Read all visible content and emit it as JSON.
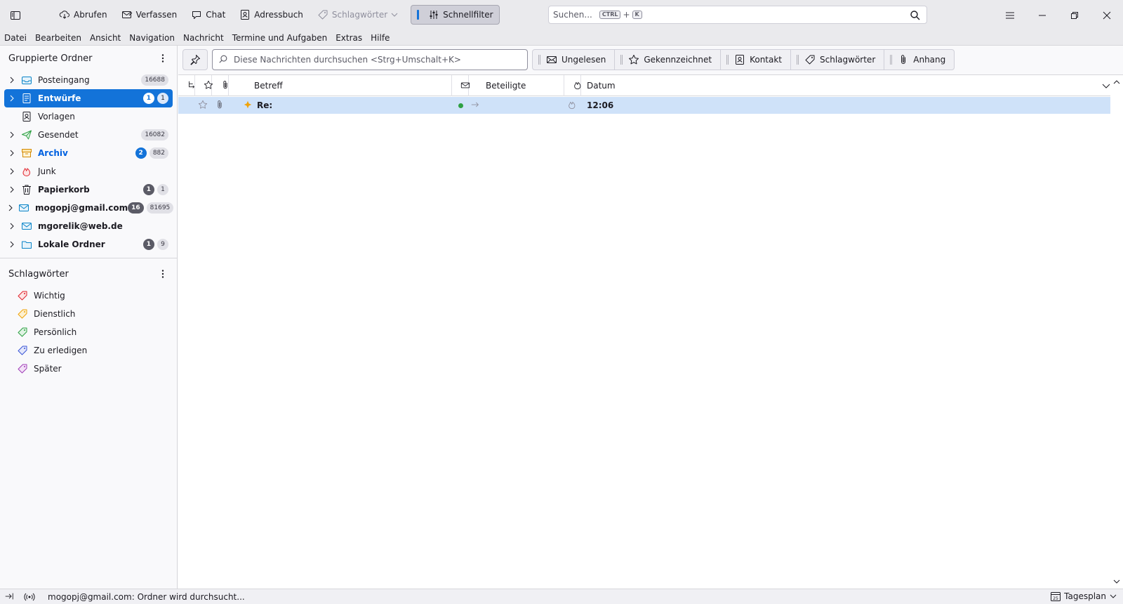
{
  "toolbar": {
    "abrufen": "Abrufen",
    "verfassen": "Verfassen",
    "chat": "Chat",
    "adressbuch": "Adressbuch",
    "schlagwoerter": "Schlagwörter",
    "schnellfilter": "Schnellfilter",
    "search_placeholder": "Suchen...",
    "search_kbd1": "CTRL",
    "search_plus": "+",
    "search_kbd2": "K"
  },
  "menu": {
    "datei": "Datei",
    "bearbeiten": "Bearbeiten",
    "ansicht": "Ansicht",
    "navigation": "Navigation",
    "nachricht": "Nachricht",
    "termine": "Termine und Aufgaben",
    "extras": "Extras",
    "hilfe": "Hilfe"
  },
  "folders": {
    "title": "Gruppierte Ordner",
    "items": [
      {
        "name": "Posteingang",
        "unread": "",
        "total": "16688"
      },
      {
        "name": "Entwürfe",
        "unread": "1",
        "total": "1"
      },
      {
        "name": "Vorlagen",
        "unread": "",
        "total": ""
      },
      {
        "name": "Gesendet",
        "unread": "",
        "total": "16082"
      },
      {
        "name": "Archiv",
        "unread": "2",
        "total": "882"
      },
      {
        "name": "Junk",
        "unread": "",
        "total": ""
      },
      {
        "name": "Papierkorb",
        "unread": "1",
        "total": "1"
      },
      {
        "name": "mogopj@gmail.com",
        "unread": "16",
        "total": "81695"
      },
      {
        "name": "mgorelik@web.de",
        "unread": "",
        "total": ""
      },
      {
        "name": "Lokale Ordner",
        "unread": "1",
        "total": "9"
      }
    ]
  },
  "tags": {
    "title": "Schlagwörter",
    "items": [
      {
        "name": "Wichtig",
        "color": "#e0242d"
      },
      {
        "name": "Dienstlich",
        "color": "#f0a30a"
      },
      {
        "name": "Persönlich",
        "color": "#2ea043"
      },
      {
        "name": "Zu erledigen",
        "color": "#3b55d6"
      },
      {
        "name": "Später",
        "color": "#a03fb7"
      }
    ]
  },
  "quickfilter": {
    "search_placeholder": "Diese Nachrichten durchsuchen <Strg+Umschalt+K>",
    "ungelesen": "Ungelesen",
    "gekennzeichnet": "Gekennzeichnet",
    "kontakt": "Kontakt",
    "schlagwoerter": "Schlagwörter",
    "anhang": "Anhang"
  },
  "thread": {
    "col_betreff": "Betreff",
    "col_beteiligte": "Beteiligte",
    "col_datum": "Datum",
    "rows": [
      {
        "subject": "Re:",
        "participants": "",
        "date": "12:06"
      }
    ]
  },
  "status": {
    "text": "mogopj@gmail.com: Ordner wird durchsucht...",
    "today_pane": "Tagesplan"
  },
  "colors": {
    "accent": "#1373d9",
    "selected_row": "#cfe2f9"
  }
}
